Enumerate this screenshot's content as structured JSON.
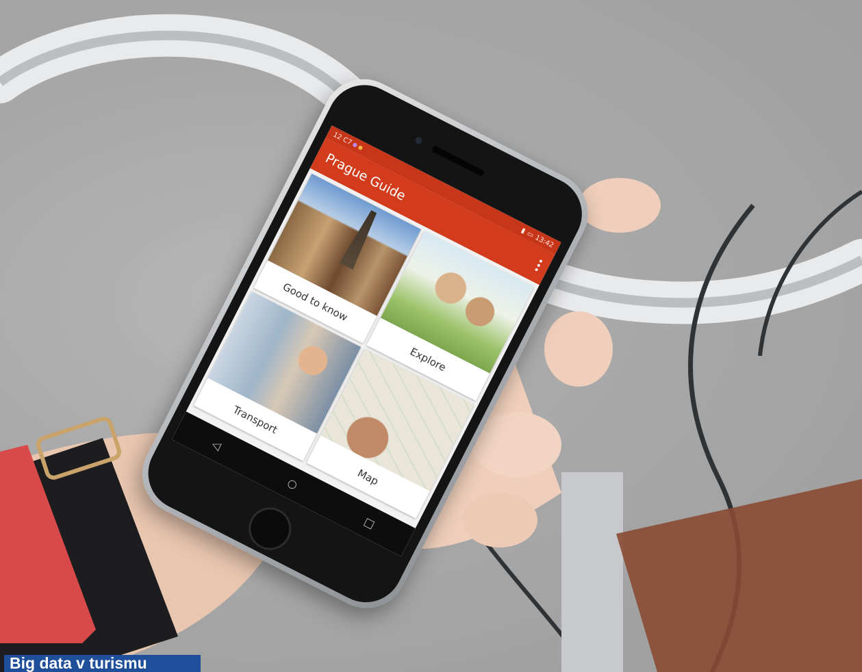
{
  "app": {
    "title": "Prague Guide",
    "status_time": "13:42",
    "status_left": "12 C7",
    "accent_color": "#d23c1c",
    "overflow_menu_icon": "more-vert-icon"
  },
  "tiles": [
    {
      "label": "Good to know"
    },
    {
      "label": "Explore"
    },
    {
      "label": "Transport"
    },
    {
      "label": "Map"
    }
  ],
  "nav": {
    "back_icon": "back-triangle-icon",
    "home_icon": "home-circle-icon",
    "recents_icon": "recents-square-icon"
  },
  "caption": {
    "text": "Big data v turismu",
    "color": "#1f4f9a"
  }
}
